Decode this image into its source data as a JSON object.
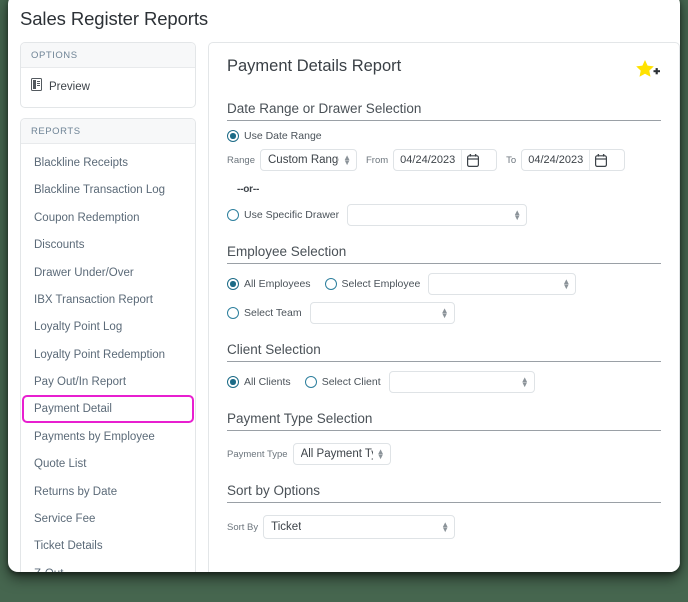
{
  "window": {
    "title": "Sales Register Reports"
  },
  "sidebar": {
    "options": {
      "header": "OPTIONS",
      "items": [
        {
          "label": "Preview",
          "icon": "report-document-icon"
        }
      ]
    },
    "reports": {
      "header": "REPORTS",
      "selected": "Payment Detail",
      "items": [
        "Blackline Receipts",
        "Blackline Transaction Log",
        "Coupon Redemption",
        "Discounts",
        "Drawer Under/Over",
        "IBX Transaction Report",
        "Loyalty Point Log",
        "Loyalty Point Redemption",
        "Pay Out/In Report",
        "Payment Detail",
        "Payments by Employee",
        "Quote List",
        "Returns by Date",
        "Service Fee",
        "Ticket Details",
        "Z-Out"
      ]
    }
  },
  "main": {
    "title": "Payment Details Report",
    "favorite_icon": "star-plus-icon",
    "sections": {
      "date_range": {
        "title": "Date Range or Drawer Selection",
        "use_date_range_label": "Use Date Range",
        "use_date_range_selected": true,
        "range_label": "Range",
        "range_value": "Custom Range",
        "from_label": "From",
        "from_value": "04/24/2023",
        "to_label": "To",
        "to_value": "04/24/2023",
        "or_text": "--or--",
        "use_specific_drawer_label": "Use Specific Drawer",
        "use_specific_drawer_selected": false,
        "drawer_value": ""
      },
      "employee": {
        "title": "Employee Selection",
        "all_employees_label": "All Employees",
        "all_employees_selected": true,
        "select_employee_label": "Select Employee",
        "select_employee_selected": false,
        "employee_value": "",
        "select_team_label": "Select Team",
        "select_team_selected": false,
        "team_value": ""
      },
      "client": {
        "title": "Client Selection",
        "all_clients_label": "All Clients",
        "all_clients_selected": true,
        "select_client_label": "Select Client",
        "select_client_selected": false,
        "client_value": ""
      },
      "payment_type": {
        "title": "Payment Type Selection",
        "label": "Payment Type",
        "value": "All Payment Types"
      },
      "sort_by": {
        "title": "Sort by Options",
        "label": "Sort By",
        "value": "Ticket"
      }
    }
  },
  "colors": {
    "accent_radio": "#1c6b87",
    "highlight_border": "#e81fd0",
    "star": "#ffe200",
    "page_bg": "#46664f"
  }
}
